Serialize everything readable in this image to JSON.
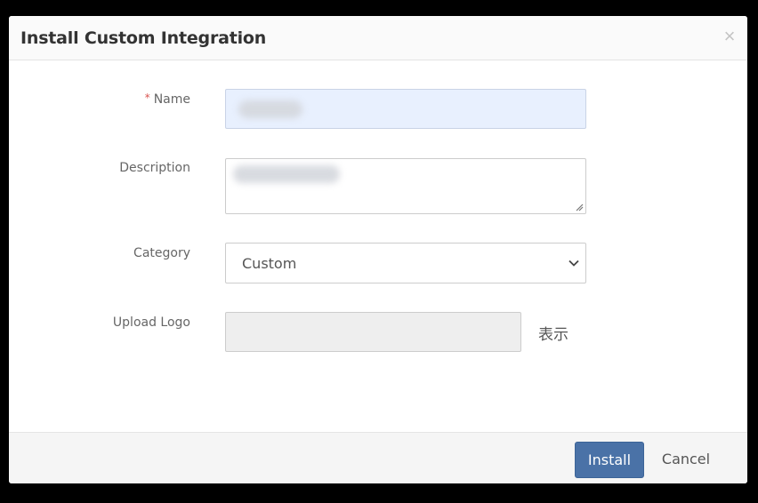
{
  "dialog": {
    "title": "Install Custom Integration",
    "close_icon": "close-icon",
    "close_glyph": "×"
  },
  "form": {
    "name": {
      "label": "Name",
      "required_mark": "*",
      "value": "",
      "autofill_color": "#e8f0fe"
    },
    "description": {
      "label": "Description",
      "value": ""
    },
    "category": {
      "label": "Category",
      "selected": "Custom",
      "icon": "chevron-down-icon"
    },
    "upload_logo": {
      "label": "Upload Logo",
      "value": "",
      "show_link": "表示"
    }
  },
  "footer": {
    "install_label": "Install",
    "cancel_label": "Cancel",
    "install_color": "#4a72a7"
  }
}
